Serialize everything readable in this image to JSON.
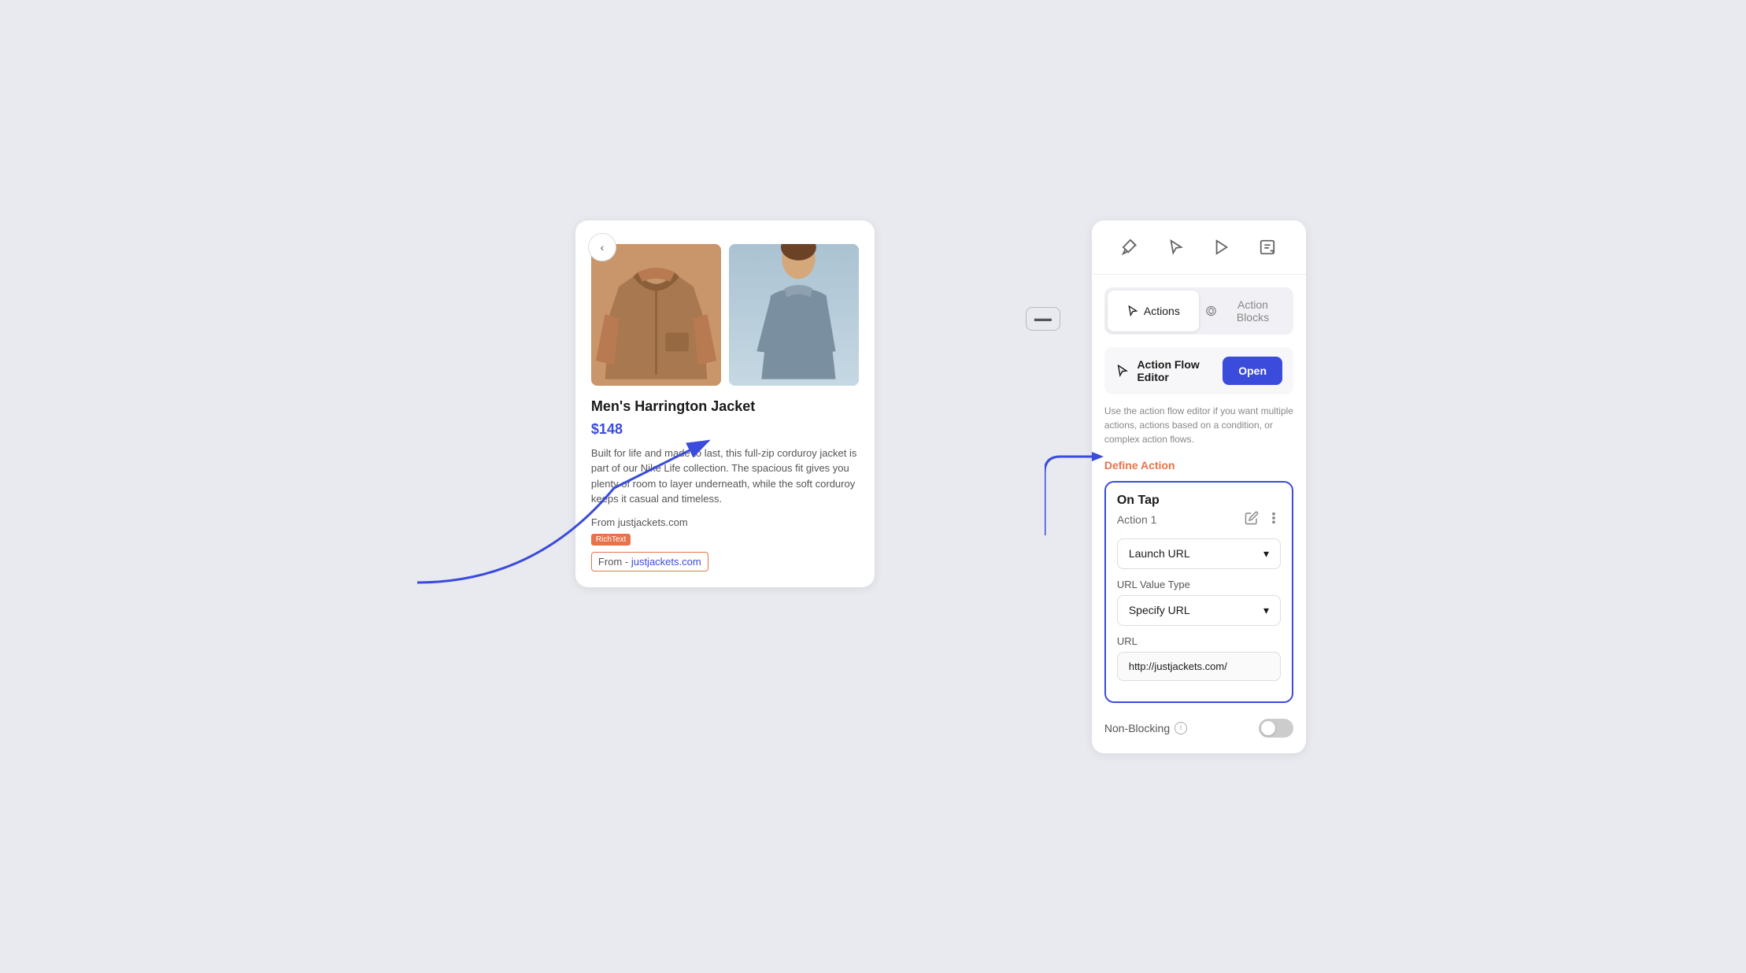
{
  "toolbar": {
    "back_label": "‹",
    "middle_btn_label": "▬▬"
  },
  "product": {
    "name": "Men's Harrington Jacket",
    "price": "$148",
    "description": "Built for life and made to last, this full-zip corduroy jacket is part of our Nike Life collection. The spacious fit gives you plenty of room to layer underneath, while the soft corduroy keeps it casual and timeless.",
    "from_plain": "From justjackets.com",
    "richtext_badge": "RichText",
    "from_label": "From -",
    "link_text": "justjackets.com",
    "link_url": "http://justjackets.com/"
  },
  "panel": {
    "tabs": [
      {
        "label": "Actions",
        "icon": "actions-icon",
        "active": true
      },
      {
        "label": "Action Blocks",
        "icon": "blocks-icon",
        "active": false
      }
    ],
    "flow_editor": {
      "label": "Action Flow Editor",
      "open_btn": "Open",
      "description": "Use the action flow editor if you want multiple actions, actions based on a condition, or complex action flows."
    },
    "define_action_label": "Define Action",
    "action_card": {
      "on_tap": "On Tap",
      "action_1": "Action 1",
      "launch_url_label": "Launch URL",
      "url_value_type_label": "URL Value Type",
      "specify_url_label": "Specify URL",
      "url_field_label": "URL",
      "url_value": "http://justjackets.com/",
      "non_blocking_label": "Non-Blocking",
      "chevron": "▾"
    }
  }
}
